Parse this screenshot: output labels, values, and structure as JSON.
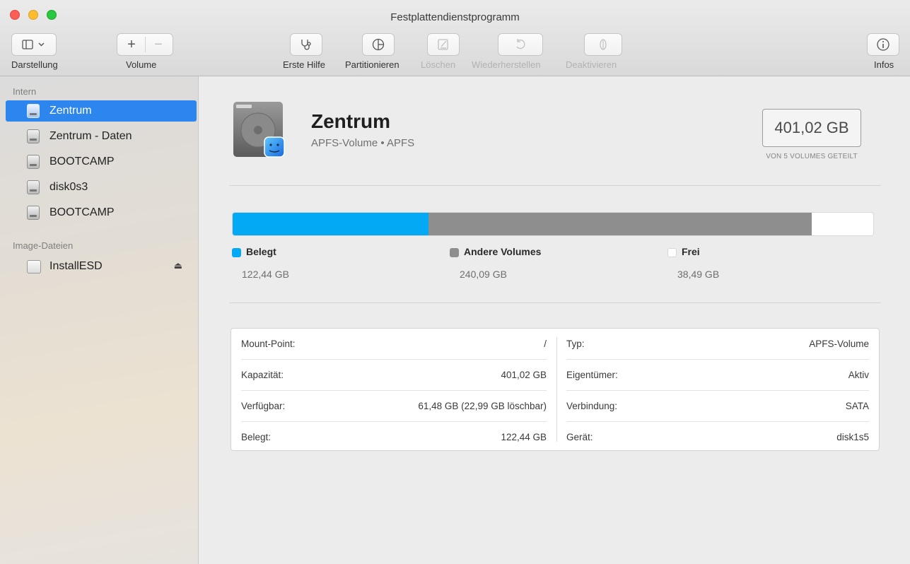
{
  "window": {
    "title": "Festplattendienstprogramm"
  },
  "toolbar": {
    "view_label": "Darstellung",
    "volume_label": "Volume",
    "first_aid_label": "Erste Hilfe",
    "partition_label": "Partitionieren",
    "erase_label": "Löschen",
    "restore_label": "Wiederherstellen",
    "unmount_label": "Deaktivieren",
    "info_label": "Infos",
    "icons": {
      "view": "sidebar-icon",
      "add": "plus-icon",
      "remove": "minus-icon",
      "first_aid": "stethoscope-icon",
      "partition": "pie-icon",
      "erase": "erase-icon",
      "restore": "restore-icon",
      "unmount": "unmount-icon",
      "info": "info-icon"
    }
  },
  "sidebar": {
    "section_internal": "Intern",
    "section_images": "Image-Dateien",
    "internal_items": [
      {
        "label": "Zentrum",
        "selected": true
      },
      {
        "label": "Zentrum - Daten",
        "selected": false
      },
      {
        "label": "BOOTCAMP",
        "selected": false
      },
      {
        "label": "disk0s3",
        "selected": false
      },
      {
        "label": "BOOTCAMP",
        "selected": false
      }
    ],
    "image_items": [
      {
        "label": "InstallESD",
        "eject": "⏏"
      }
    ],
    "selection_color": "#2d86ee"
  },
  "volume": {
    "name": "Zentrum",
    "subtitle": "APFS-Volume • APFS",
    "capacity": "401,02 GB",
    "capacity_note": "VON 5 VOLUMES GETEILT"
  },
  "usage": {
    "total_gb": 401.02,
    "segments": [
      {
        "name": "Belegt",
        "value": "122,44 GB",
        "gb": 122.44,
        "color": "#03a9f4"
      },
      {
        "name": "Andere Volumes",
        "value": "240,09 GB",
        "gb": 240.09,
        "color": "#8e8e8e"
      },
      {
        "name": "Frei",
        "value": "38,49 GB",
        "gb": 38.49,
        "color": "#ffffff"
      }
    ]
  },
  "details": {
    "left": [
      {
        "key": "Mount-Point:",
        "value": "/"
      },
      {
        "key": "Kapazität:",
        "value": "401,02 GB"
      },
      {
        "key": "Verfügbar:",
        "value": "61,48 GB (22,99 GB löschbar)"
      },
      {
        "key": "Belegt:",
        "value": "122,44 GB"
      }
    ],
    "right": [
      {
        "key": "Typ:",
        "value": "APFS-Volume"
      },
      {
        "key": "Eigentümer:",
        "value": "Aktiv"
      },
      {
        "key": "Verbindung:",
        "value": "SATA"
      },
      {
        "key": "Gerät:",
        "value": "disk1s5"
      }
    ]
  }
}
